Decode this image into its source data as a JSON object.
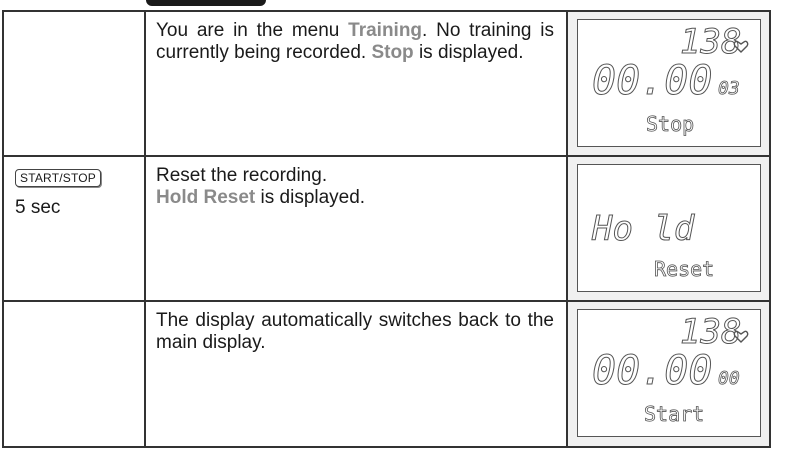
{
  "rows": [
    {
      "key": "",
      "duration": "",
      "desc": {
        "before": "You are in the menu ",
        "kw1": "Training",
        "middle": ". No training is currently being recorded. ",
        "kw2": "Stop",
        "after": " is displayed."
      },
      "display": {
        "top": "138",
        "main": "00.00",
        "suffix": "03",
        "label": "Stop",
        "heart_icon": "heart-icon"
      }
    },
    {
      "key": "START/STOP",
      "duration": "5 sec",
      "desc": {
        "line1": "Reset the recording.",
        "kw": "Hold Reset",
        "after": " is displayed."
      },
      "display": {
        "word1": "Ho ld",
        "label": "Reset"
      }
    },
    {
      "key": "",
      "duration": "",
      "desc": {
        "text": "The display automatically switches back to the main display."
      },
      "display": {
        "top": "138",
        "main": "00.00",
        "suffix": "00",
        "label": "Start",
        "heart_icon": "heart-icon"
      }
    }
  ]
}
